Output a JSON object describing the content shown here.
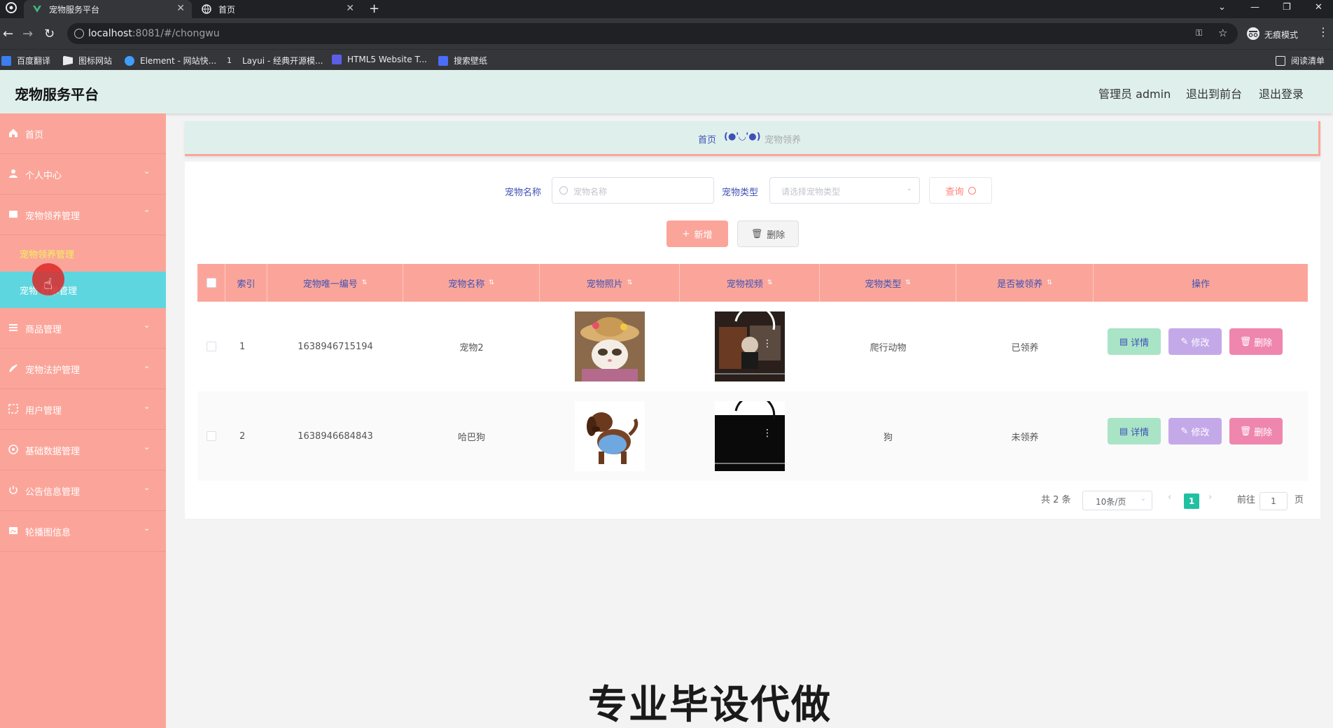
{
  "browser": {
    "tabs": [
      {
        "label": "宠物服务平台",
        "active": true
      },
      {
        "label": "首页",
        "active": false
      }
    ],
    "new_tab_label": "+",
    "url_host": "localhost",
    "url_path": ":8081/#/chongwu",
    "incognito_label": "无痕模式",
    "bookmarks": [
      "百度翻译",
      "图标网站",
      "Element - 网站快...",
      "Layui - 经典开源模...",
      "HTML5 Website T...",
      "搜索壁纸"
    ],
    "reading_list_label": "阅读清单"
  },
  "header": {
    "title": "宠物服务平台",
    "admin_label": "管理员 admin",
    "front_link": "退出到前台",
    "logout_link": "退出登录"
  },
  "sidebar": {
    "items": [
      {
        "label": "首页",
        "icon": "home-icon"
      },
      {
        "label": "个人中心",
        "icon": "user-icon"
      },
      {
        "label": "宠物领养管理",
        "icon": "pet-manage-icon"
      },
      {
        "label": "商品管理",
        "icon": "list-icon"
      },
      {
        "label": "宠物法护管理",
        "icon": "care-icon"
      },
      {
        "label": "用户管理",
        "icon": "users-icon"
      },
      {
        "label": "基础数据管理",
        "icon": "data-icon"
      },
      {
        "label": "公告信息管理",
        "icon": "notice-icon"
      },
      {
        "label": "轮播图信息",
        "icon": "carousel-icon"
      }
    ],
    "sub_items": [
      "宠物领养管理",
      "宠物  订单管理"
    ],
    "active_sub_color": "#5ed6e0"
  },
  "breadcrumb": {
    "home": "首页",
    "face": "(●'◡'●)",
    "current": "宠物领养"
  },
  "search": {
    "name_label": "宠物名称",
    "name_placeholder": "宠物名称",
    "type_label": "宠物类型",
    "type_placeholder": "请选择宠物类型",
    "query_button": "查询"
  },
  "actions": {
    "add_button": "新增",
    "delete_button": "删除"
  },
  "table": {
    "columns": [
      "索引",
      "宠物唯一编号",
      "宠物名称",
      "宠物照片",
      "宠物视频",
      "宠物类型",
      "是否被领养",
      "操作"
    ],
    "rows": [
      {
        "index": "1",
        "code": "1638946715194",
        "name": "宠物2",
        "photo": "cat-in-hat",
        "video": "video-thumb",
        "type": "爬行动物",
        "adopted": "已领养"
      },
      {
        "index": "2",
        "code": "1638946684843",
        "name": "哈巴狗",
        "photo": "dog-in-shirt",
        "video": "video-thumb",
        "type": "狗",
        "adopted": "未领养"
      }
    ],
    "ops": {
      "detail": "详情",
      "edit": "修改",
      "delete": "删除"
    }
  },
  "pagination": {
    "total_label": "共 2 条",
    "page_size": "10条/页",
    "current_page": "1",
    "goto_prefix": "前往",
    "goto_value": "1",
    "goto_suffix": "页"
  },
  "watermark_text": "专业毕设代做",
  "colors": {
    "sidebar_bg": "#fba59a",
    "header_bg": "#dff0ec",
    "table_header_bg": "#fba59a",
    "active_page": "#21c0a0",
    "detail_button": "#a9e4c6",
    "edit_button": "#c4a9e8",
    "delete_button": "#ef86ad"
  }
}
